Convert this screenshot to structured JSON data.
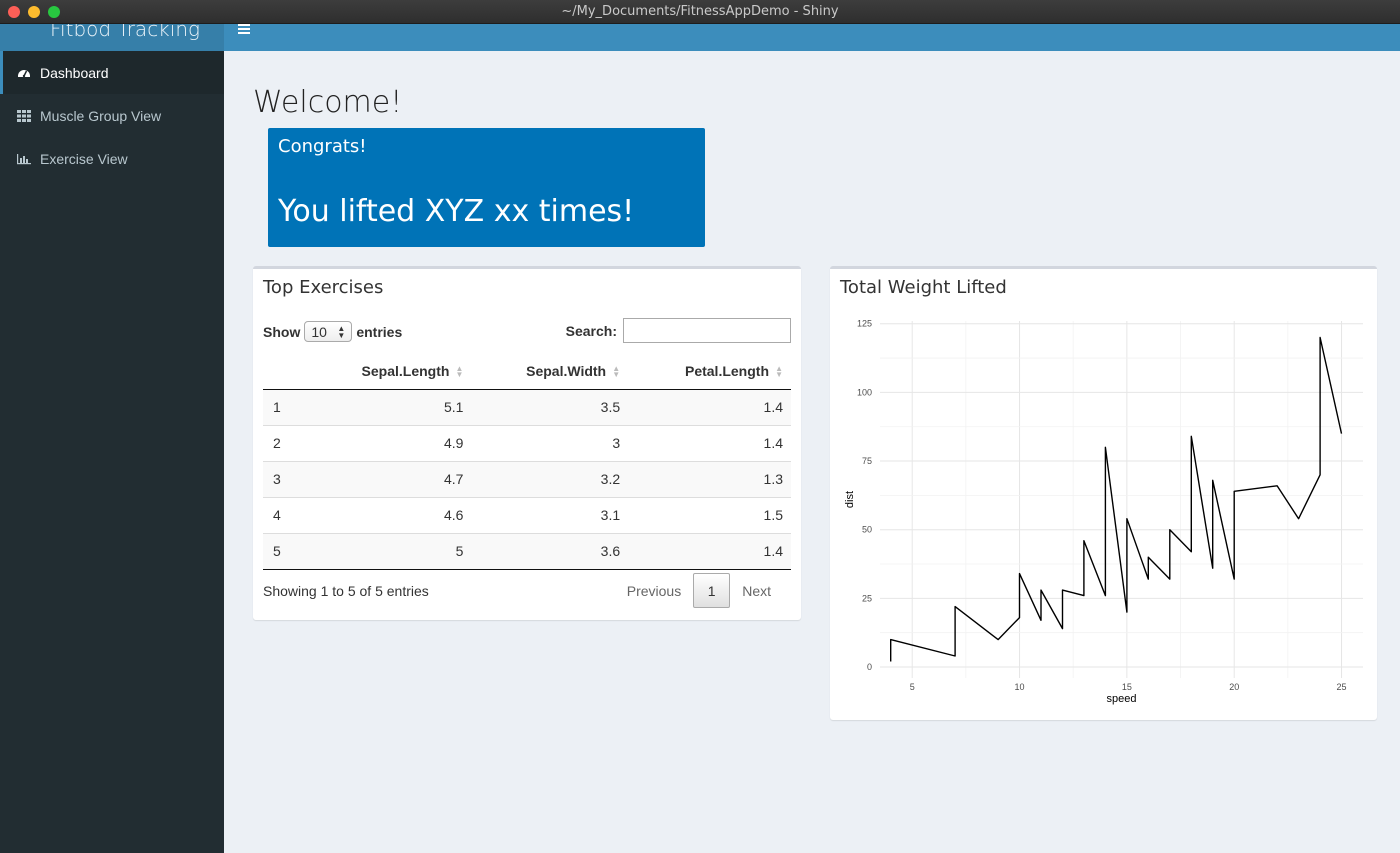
{
  "window": {
    "title": "~/My_Documents/FitnessAppDemo - Shiny"
  },
  "header": {
    "logo": "Fitbod Tracking"
  },
  "sidebar": {
    "items": [
      {
        "label": "Dashboard",
        "icon": "dashboard-icon",
        "active": true
      },
      {
        "label": "Muscle Group View",
        "icon": "th-icon",
        "active": false
      },
      {
        "label": "Exercise View",
        "icon": "bar-chart-icon",
        "active": false
      }
    ]
  },
  "main": {
    "welcome": "Welcome!",
    "value_box": {
      "title": "Congrats!",
      "value": "You lifted XYZ xx times!",
      "color": "#0073b7"
    }
  },
  "table_box": {
    "title": "Top Exercises",
    "show_label": "Show",
    "show_value": "10",
    "entries_label": "entries",
    "search_label": "Search:",
    "search_value": "",
    "columns": [
      "",
      "Sepal.Length",
      "Sepal.Width",
      "Petal.Length"
    ],
    "rows": [
      [
        "1",
        "5.1",
        "3.5",
        "1.4"
      ],
      [
        "2",
        "4.9",
        "3",
        "1.4"
      ],
      [
        "3",
        "4.7",
        "3.2",
        "1.3"
      ],
      [
        "4",
        "4.6",
        "3.1",
        "1.5"
      ],
      [
        "5",
        "5",
        "3.6",
        "1.4"
      ]
    ],
    "info": "Showing 1 to 5 of 5 entries",
    "pager": {
      "previous": "Previous",
      "current": "1",
      "next": "Next"
    }
  },
  "chart_box": {
    "title": "Total Weight Lifted"
  },
  "chart_data": {
    "type": "line",
    "title": "",
    "xlabel": "speed",
    "ylabel": "dist",
    "xlim": [
      3.5,
      26
    ],
    "ylim": [
      -4,
      126
    ],
    "xticks": [
      5,
      10,
      15,
      20,
      25
    ],
    "yticks": [
      0,
      25,
      50,
      75,
      100,
      125
    ],
    "grid": true,
    "legend": "none",
    "series": [
      {
        "color": "#000000",
        "x": [
          4,
          4,
          7,
          7,
          8,
          9,
          10,
          10,
          10,
          11,
          11,
          12,
          12,
          12,
          12,
          13,
          13,
          13,
          13,
          14,
          14,
          14,
          14,
          15,
          15,
          15,
          16,
          16,
          17,
          17,
          17,
          18,
          18,
          18,
          18,
          19,
          19,
          19,
          20,
          20,
          20,
          20,
          20,
          22,
          23,
          24,
          24,
          24,
          24,
          25
        ],
        "y": [
          2,
          10,
          4,
          22,
          16,
          10,
          18,
          26,
          34,
          17,
          28,
          14,
          20,
          24,
          28,
          26,
          34,
          34,
          46,
          26,
          36,
          60,
          80,
          20,
          26,
          54,
          32,
          40,
          32,
          40,
          50,
          42,
          56,
          76,
          84,
          36,
          46,
          68,
          32,
          48,
          52,
          56,
          64,
          66,
          54,
          70,
          92,
          93,
          120,
          85
        ]
      }
    ]
  }
}
